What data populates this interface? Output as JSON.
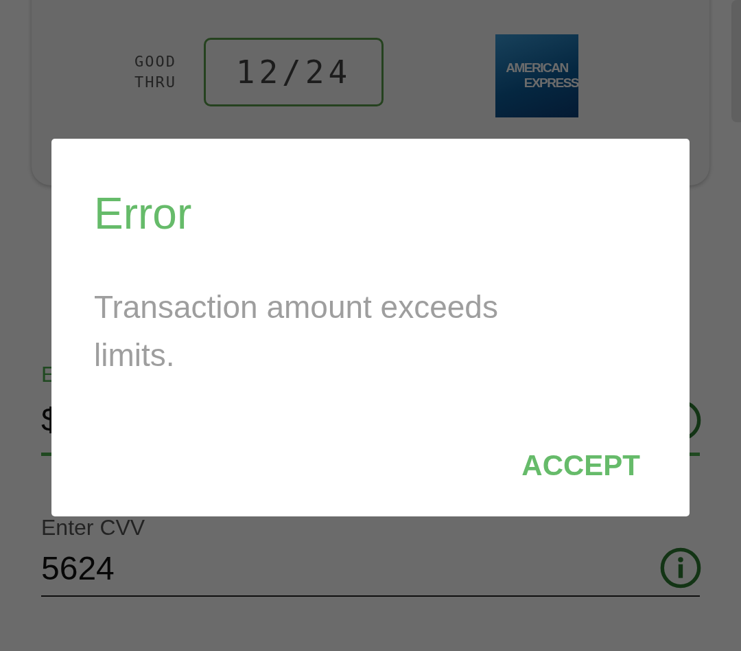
{
  "card": {
    "expiry_caption": [
      "GOOD",
      "THRU"
    ],
    "expiry": "12/24",
    "brand_logo": [
      "AMERICAN",
      "EXPRESS"
    ]
  },
  "amount_field": {
    "label": "E",
    "value": "$",
    "focused": true
  },
  "cvv_field": {
    "label": "Enter CVV",
    "value": "5624",
    "focused": false
  },
  "dialog": {
    "title": "Error",
    "message": "Transaction amount exceeds limits.",
    "button": "ACCEPT"
  }
}
